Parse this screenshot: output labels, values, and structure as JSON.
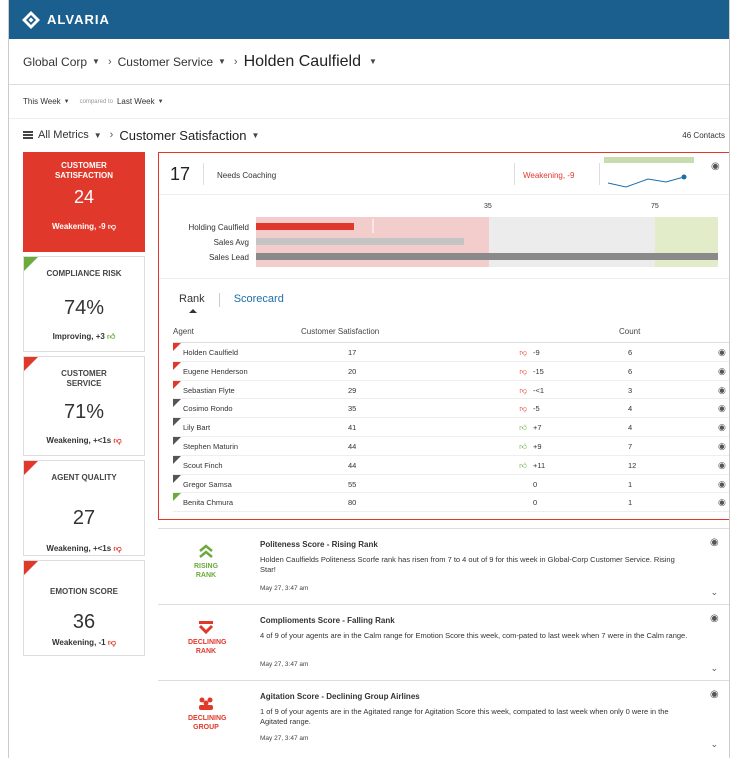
{
  "brand": {
    "name": "ALVARIA"
  },
  "breadcrumb": {
    "org": "Global Corp",
    "dept": "Customer Service",
    "agent": "Holden Caulfield"
  },
  "timefilter": {
    "period": "This Week",
    "compared_label": "compared to",
    "compare_period": "Last Week"
  },
  "metrics_header": {
    "all_metrics": "All Metrics",
    "current_metric": "Customer Satisfaction",
    "contacts": "46 Contacts"
  },
  "metric_cards": [
    {
      "title": "CUSTOMER SATISFACTION",
      "value": "24",
      "status": "Weakening, -9",
      "trend": "down"
    },
    {
      "title": "COMPLIANCE RISK",
      "value": "74%",
      "status": "Improving, +3",
      "trend": "up"
    },
    {
      "title": "CUSTOMER SERVICE",
      "value": "71%",
      "status": "Weakening, +<1s",
      "trend": "down"
    },
    {
      "title": "AGENT QUALITY",
      "value": "27",
      "status": "Weakening, +<1s",
      "trend": "down"
    },
    {
      "title": "EMOTION SCORE",
      "value": "36",
      "status": "Weakening, -1",
      "trend": "down"
    }
  ],
  "detail": {
    "value": "17",
    "status_label": "Needs Coaching",
    "trend_label": "Weakening, -9",
    "bullet": {
      "ticks": [
        "35",
        "75"
      ],
      "tick_values": [
        35,
        75
      ],
      "max": 80,
      "rows": [
        {
          "label": "Holding Caulfield",
          "value": 17
        },
        {
          "label": "Sales Avg",
          "value": 36
        },
        {
          "label": "Sales Lead",
          "value": 80
        }
      ]
    },
    "tabs": {
      "rank": "Rank",
      "scorecard": "Scorecard"
    },
    "table": {
      "headers": {
        "agent": "Agent",
        "score": "Customer Satisfaction",
        "count": "Count"
      },
      "rows": [
        {
          "agent": "Holden Caulfield",
          "score": "17",
          "delta": "-9",
          "trend": "down",
          "count": "6",
          "flag": "red"
        },
        {
          "agent": "Eugene Henderson",
          "score": "20",
          "delta": "-15",
          "trend": "down",
          "count": "6",
          "flag": "red"
        },
        {
          "agent": "Sebastian Flyte",
          "score": "29",
          "delta": "-<1",
          "trend": "down",
          "count": "3",
          "flag": "red"
        },
        {
          "agent": "Cosimo Rondo",
          "score": "35",
          "delta": "-5",
          "trend": "down",
          "count": "4",
          "flag": "dark"
        },
        {
          "agent": "Lily Bart",
          "score": "41",
          "delta": "+7",
          "trend": "up",
          "count": "4",
          "flag": "dark"
        },
        {
          "agent": "Stephen Maturin",
          "score": "44",
          "delta": "+9",
          "trend": "up",
          "count": "7",
          "flag": "dark"
        },
        {
          "agent": "Scout Finch",
          "score": "44",
          "delta": "+11",
          "trend": "up",
          "count": "12",
          "flag": "dark"
        },
        {
          "agent": "Gregor Samsa",
          "score": "55",
          "delta": "0",
          "trend": "none",
          "count": "1",
          "flag": "dark"
        },
        {
          "agent": "Benita Chmura",
          "score": "80",
          "delta": "0",
          "trend": "none",
          "count": "1",
          "flag": "green"
        }
      ]
    }
  },
  "insights": [
    {
      "icon": "rising-rank-icon",
      "tag": "RISING RANK",
      "color": "#6aab3b",
      "title": "Politeness Score - Rising Rank",
      "body": "Holden Caulfields Politeness Scorfe rank has risen from 7 to 4 out of 9 for this week in Global-Corp Customer Service. Rising Star!",
      "date": "May 27, 3:47 am"
    },
    {
      "icon": "declining-rank-icon",
      "tag": "DECLINING RANK",
      "color": "#e0392b",
      "title": "Complioments Score - Falling Rank",
      "body": "4 of 9 of your agents are in the Calm range for Emotion Score this week, com-pated to last week when 7 were in the Calm range.",
      "date": "May 27, 3:47 am"
    },
    {
      "icon": "declining-group-icon",
      "tag": "DECLINING GROUP",
      "color": "#e0392b",
      "title": "Agitation Score - Declining Group Airlines",
      "body": "1 of 9 of your agents are in the Agitated range for Agitation Score this week, compated to last week when only 0 were in the Agitated range.",
      "date": "May 27, 3:47 am"
    }
  ]
}
